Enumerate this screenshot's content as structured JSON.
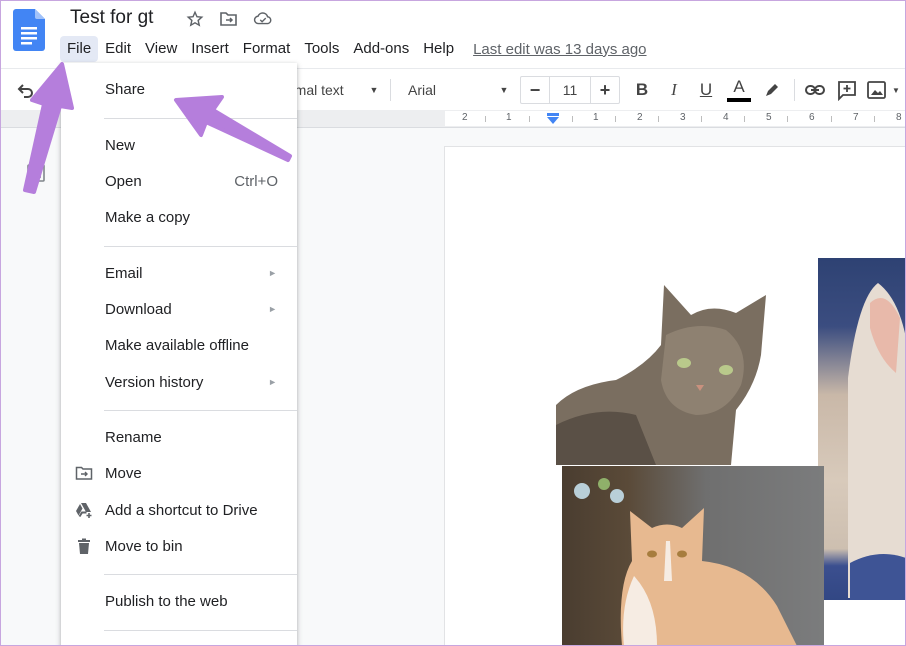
{
  "header": {
    "doc_title": "Test for gt",
    "title_icons": [
      "star-icon",
      "move-to-folder-icon",
      "cloud-saved-icon"
    ],
    "menu": [
      "File",
      "Edit",
      "View",
      "Insert",
      "Format",
      "Tools",
      "Add-ons",
      "Help"
    ],
    "active_menu": "File",
    "last_edit": "Last edit was 13 days ago"
  },
  "toolbar": {
    "undo_icon": "undo-icon",
    "style_select": "Normal text",
    "style_select_visible": "rmal text",
    "font_select": "Arial",
    "font_size": "11",
    "decrease_label": "−",
    "increase_label": "+",
    "bold": "B",
    "italic": "I",
    "underline": "U",
    "text_color": "A",
    "text_color_value": "#000000",
    "icons": [
      "highlight-pen-icon",
      "link-icon",
      "add-comment-icon",
      "insert-image-icon"
    ]
  },
  "ruler": {
    "labels": [
      "2",
      "1",
      "1",
      "2",
      "3",
      "4",
      "5",
      "6",
      "7",
      "8"
    ],
    "indent_marker_color": "#4285f4"
  },
  "file_menu": {
    "items": [
      {
        "label": "Share"
      },
      {
        "label": "New",
        "submenu": true
      },
      {
        "label": "Open",
        "shortcut": "Ctrl+O"
      },
      {
        "label": "Make a copy"
      },
      {
        "label": "Email",
        "submenu": true
      },
      {
        "label": "Download",
        "submenu": true
      },
      {
        "label": "Make available offline"
      },
      {
        "label": "Version history",
        "submenu": true
      },
      {
        "label": "Rename"
      },
      {
        "label": "Move",
        "icon": "folder-move-icon"
      },
      {
        "label": "Add a shortcut to Drive",
        "icon": "drive-shortcut-icon"
      },
      {
        "label": "Move to bin",
        "icon": "trash-icon"
      },
      {
        "label": "Publish to the web"
      }
    ],
    "submenu_arrow": "►"
  },
  "document": {
    "images": [
      "tabby-cat-image",
      "white-cat-image",
      "ginger-cat-image"
    ]
  },
  "colors": {
    "annotation_arrow": "#b57edc",
    "docs_blue": "#4285f4",
    "menu_active_bg": "#e4e9f5"
  }
}
